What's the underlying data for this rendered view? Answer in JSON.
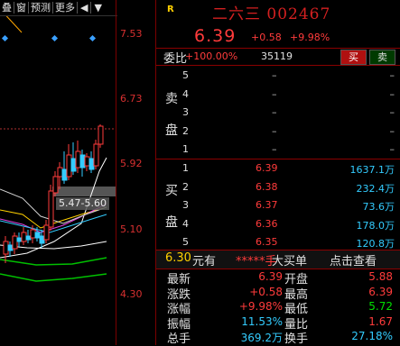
{
  "toolbar": {
    "buttons": [
      "叠",
      "窗",
      "预测",
      "更多"
    ],
    "icons": [
      "scissors-icon",
      "grid-icon",
      "play-left-icon",
      "menu-down-icon"
    ]
  },
  "chart": {
    "price_ticks": [
      "7.53",
      "6.73",
      "5.92",
      "5.10",
      "4.30"
    ],
    "range_label": "5.47-5.60"
  },
  "quote": {
    "badge": "R",
    "name_code": "二六三 002467",
    "price": "6.39",
    "change": "+0.58",
    "change_pct": "+9.98%",
    "ratio_label": "委比",
    "ratio_value": "+100.00%",
    "ratio_diff": "35119",
    "buy_label": "买",
    "sell_label": "卖"
  },
  "orderbook": {
    "sell_label_chars": [
      "卖",
      "盘"
    ],
    "asks": [
      {
        "level": "5",
        "price": "–",
        "vol": "–"
      },
      {
        "level": "4",
        "price": "–",
        "vol": "–"
      },
      {
        "level": "3",
        "price": "–",
        "vol": "–"
      },
      {
        "level": "2",
        "price": "–",
        "vol": "–"
      },
      {
        "level": "1",
        "price": "–",
        "vol": "–"
      }
    ],
    "buy_label_chars": [
      "买",
      "盘"
    ],
    "bids": [
      {
        "level": "1",
        "price": "6.39",
        "vol": "1637.1万"
      },
      {
        "level": "2",
        "price": "6.38",
        "vol": "232.4万"
      },
      {
        "level": "3",
        "price": "6.37",
        "vol": "73.6万"
      },
      {
        "level": "4",
        "price": "6.36",
        "vol": "178.0万"
      },
      {
        "level": "5",
        "price": "6.35",
        "vol": "120.8万"
      }
    ]
  },
  "small_order": {
    "price": "6.30",
    "unit": "元有",
    "stars": "*****手",
    "label": "大买单",
    "link": "点击查看"
  },
  "stats": [
    {
      "l1": "最新",
      "v1": "6.39",
      "c1": "red",
      "l2": "开盘",
      "v2": "5.88",
      "c2": "red"
    },
    {
      "l1": "涨跌",
      "v1": "+0.58",
      "c1": "red",
      "l2": "最高",
      "v2": "6.39",
      "c2": "red"
    },
    {
      "l1": "涨幅",
      "v1": "+9.98%",
      "c1": "red",
      "l2": "最低",
      "v2": "5.72",
      "c2": "green"
    },
    {
      "l1": "振幅",
      "v1": "11.53%",
      "c1": "cyan",
      "l2": "量比",
      "v2": "1.67",
      "c2": "red"
    },
    {
      "l1": "总手",
      "v1": "369.2万",
      "c1": "cyan",
      "l2": "换手",
      "v2": "27.18%",
      "c2": "cyan"
    }
  ],
  "colors": {
    "up": "#ff3b3b",
    "down": "#00e000",
    "volume": "#33ccff",
    "grid": "#8a0000"
  }
}
